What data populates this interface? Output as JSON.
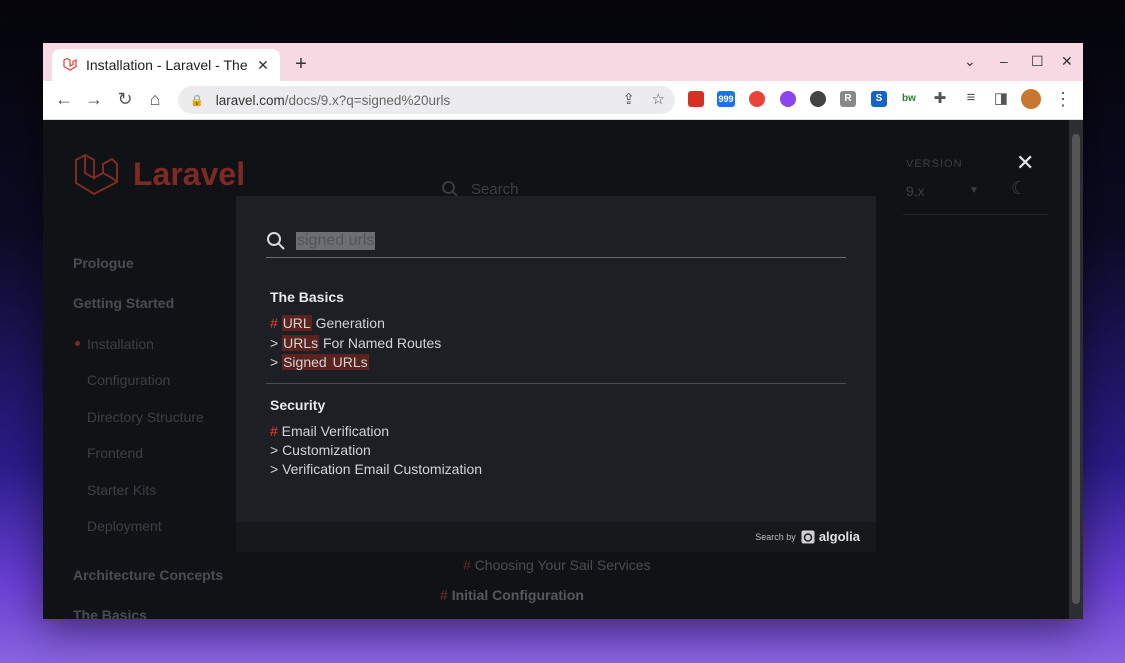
{
  "browser": {
    "tab_title": "Installation - Laravel - The",
    "tab_close": "✕",
    "new_tab": "+",
    "url_host": "laravel.com",
    "url_path": "/docs/9.x?q=signed%20urls",
    "extensions": [
      {
        "name": "book-extension",
        "color": "#d93025",
        "text": ""
      },
      {
        "name": "rss-extension-999",
        "color": "#1a73e8",
        "text": "999"
      },
      {
        "name": "red-circle-extension",
        "color": "#ea4335",
        "text": ""
      },
      {
        "name": "purple-extension",
        "color": "#8e44ec",
        "text": ""
      },
      {
        "name": "r-extension",
        "color": "#888888",
        "text": "R"
      },
      {
        "name": "s-extension",
        "color": "#1565c0",
        "text": "S"
      },
      {
        "name": "bw-extension",
        "color": "#2e7d32",
        "text": "bw"
      }
    ]
  },
  "site": {
    "logo_text": "Laravel",
    "search_placeholder": "Search",
    "version_label": "VERSION",
    "version_value": "9.x",
    "sidebar": {
      "sections": [
        "Prologue",
        "Getting Started",
        "Architecture Concepts",
        "The Basics"
      ],
      "items": [
        "Installation",
        "Configuration",
        "Directory Structure",
        "Frontend",
        "Starter Kits",
        "Deployment"
      ]
    },
    "content_hash": "#",
    "content_1": "Choosing Your Sail Services",
    "content_2": "Initial Configuration"
  },
  "modal": {
    "query": "signed urls",
    "groups": [
      {
        "title": "The Basics",
        "r1_hash": "#",
        "r1_mark": "URL",
        "r1_rest": " Generation",
        "r2_prefix": "> ",
        "r2_mark": "URLs",
        "r2_rest": " For Named Routes",
        "r3_prefix": "> ",
        "r3_mark1": "Signed",
        "r3_mark2": "URLs"
      },
      {
        "title": "Security",
        "r1_hash": "#",
        "r1_rest": " Email Verification",
        "r2": "> Customization",
        "r3": "> Verification Email Customization"
      }
    ],
    "footer_search_by": "Search by",
    "footer_brand": "algolia"
  },
  "colors": {
    "accent_red": "#ef3b2d",
    "page_bg": "#111216",
    "modal_bg": "#1d1f25"
  }
}
